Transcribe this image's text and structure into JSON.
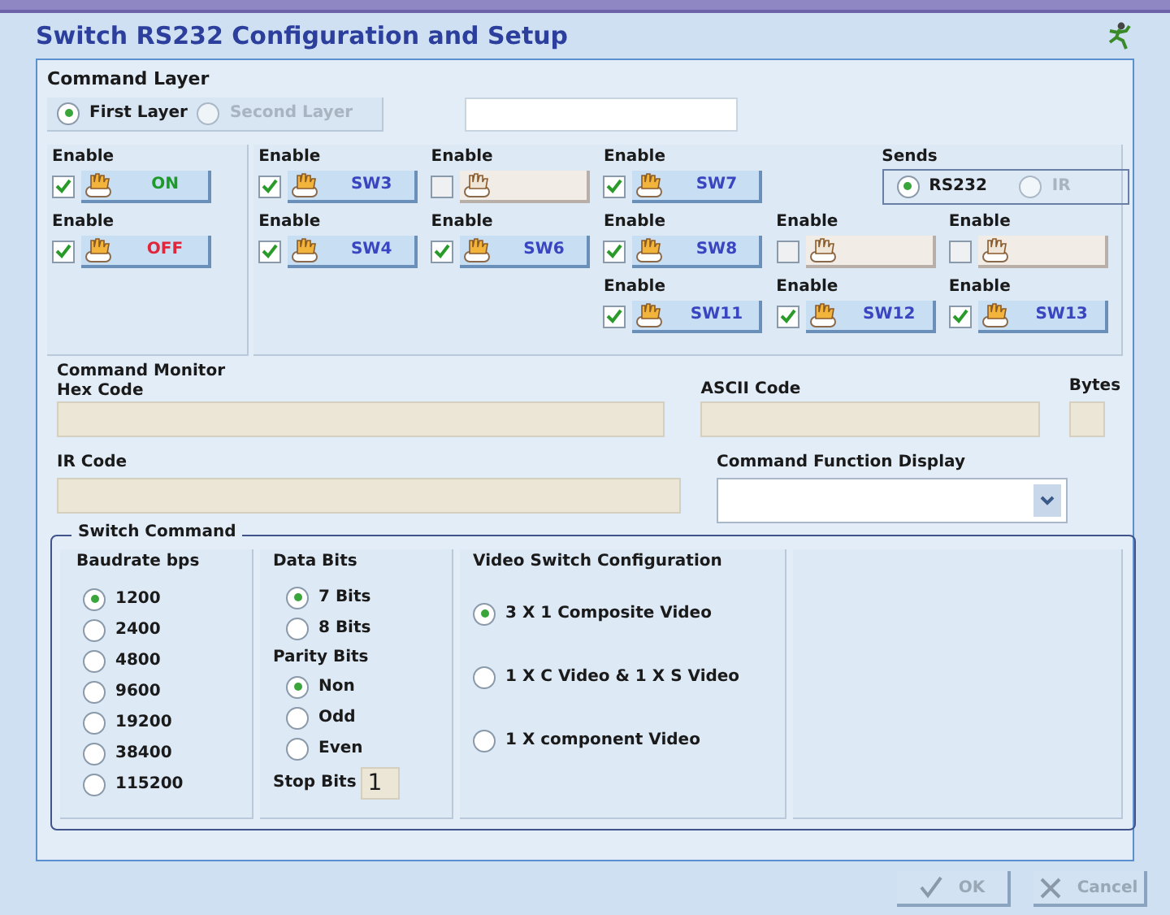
{
  "window": {
    "title": "Switch RS232 Configuration and Setup"
  },
  "command_layer": {
    "title": "Command Layer",
    "options": [
      {
        "label": "First Layer",
        "selected": true,
        "disabled": false
      },
      {
        "label": "Second Layer",
        "selected": false,
        "disabled": true
      }
    ]
  },
  "switch_groups": [
    {
      "rows": [
        [
          {
            "kind": "switch",
            "enable_label": "Enable",
            "enabled": true,
            "label": "ON",
            "color": "#1e9a2a"
          }
        ],
        [
          {
            "kind": "switch",
            "enable_label": "Enable",
            "enabled": true,
            "label": "OFF",
            "color": "#e0263a"
          }
        ]
      ]
    },
    {
      "rows": [
        [
          {
            "kind": "switch",
            "enable_label": "Enable",
            "enabled": true,
            "label": "SW3",
            "color": "#3a45c0"
          },
          {
            "kind": "switch",
            "enable_label": "Enable",
            "enabled": false
          },
          {
            "kind": "switch",
            "enable_label": "Enable",
            "enabled": true,
            "label": "SW7",
            "color": "#3a45c0"
          }
        ],
        [
          {
            "kind": "switch",
            "enable_label": "Enable",
            "enabled": true,
            "label": "SW4",
            "color": "#3a45c0"
          },
          {
            "kind": "switch",
            "enable_label": "Enable",
            "enabled": true,
            "label": "SW6",
            "color": "#3a45c0"
          },
          {
            "kind": "switch",
            "enable_label": "Enable",
            "enabled": true,
            "label": "SW8",
            "color": "#3a45c0"
          },
          {
            "kind": "switch",
            "enable_label": "Enable",
            "enabled": false
          },
          {
            "kind": "switch",
            "enable_label": "Enable",
            "enabled": false
          }
        ],
        [
          {
            "kind": "spacer"
          },
          {
            "kind": "spacer"
          },
          {
            "kind": "switch",
            "enable_label": "Enable",
            "enabled": true,
            "label": "SW11",
            "color": "#3a45c0"
          },
          {
            "kind": "switch",
            "enable_label": "Enable",
            "enabled": true,
            "label": "SW12",
            "color": "#3a45c0"
          },
          {
            "kind": "switch",
            "enable_label": "Enable",
            "enabled": true,
            "label": "SW13",
            "color": "#3a45c0"
          }
        ]
      ]
    }
  ],
  "sends": {
    "title": "Sends",
    "options": [
      {
        "label": "RS232",
        "selected": true,
        "disabled": false
      },
      {
        "label": "IR",
        "selected": false,
        "disabled": true
      }
    ]
  },
  "command_monitor": {
    "title": "Command Monitor",
    "hex_code": "Hex Code",
    "ascii_code": "ASCII Code",
    "bytes": "Bytes",
    "ir_code": "IR Code",
    "function_display": "Command Function Display"
  },
  "switch_command": {
    "title": "Switch Command",
    "baudrate": {
      "title": "Baudrate bps",
      "options": [
        {
          "label": "1200",
          "selected": true
        },
        {
          "label": "2400",
          "selected": false
        },
        {
          "label": "4800",
          "selected": false
        },
        {
          "label": "9600",
          "selected": false
        },
        {
          "label": "19200",
          "selected": false
        },
        {
          "label": "38400",
          "selected": false
        },
        {
          "label": "115200",
          "selected": false
        }
      ]
    },
    "data_bits": {
      "title": "Data Bits",
      "options": [
        {
          "label": "7 Bits",
          "selected": true
        },
        {
          "label": "8 Bits",
          "selected": false
        }
      ]
    },
    "parity_bits": {
      "title": "Parity Bits",
      "options": [
        {
          "label": "Non",
          "selected": true
        },
        {
          "label": "Odd",
          "selected": false
        },
        {
          "label": "Even",
          "selected": false
        }
      ]
    },
    "stop_bits": {
      "label": "Stop Bits",
      "value": "1"
    },
    "video": {
      "title": "Video Switch Configuration",
      "options": [
        {
          "label": "3 X 1 Composite Video",
          "selected": true
        },
        {
          "label": "1 X C Video & 1 X S Video",
          "selected": false
        },
        {
          "label": "1 X component Video",
          "selected": false
        }
      ]
    }
  },
  "buttons": [
    {
      "label": "OK",
      "kind": "ok",
      "disabled": true
    },
    {
      "label": "Cancel",
      "kind": "cancel",
      "disabled": true
    }
  ]
}
